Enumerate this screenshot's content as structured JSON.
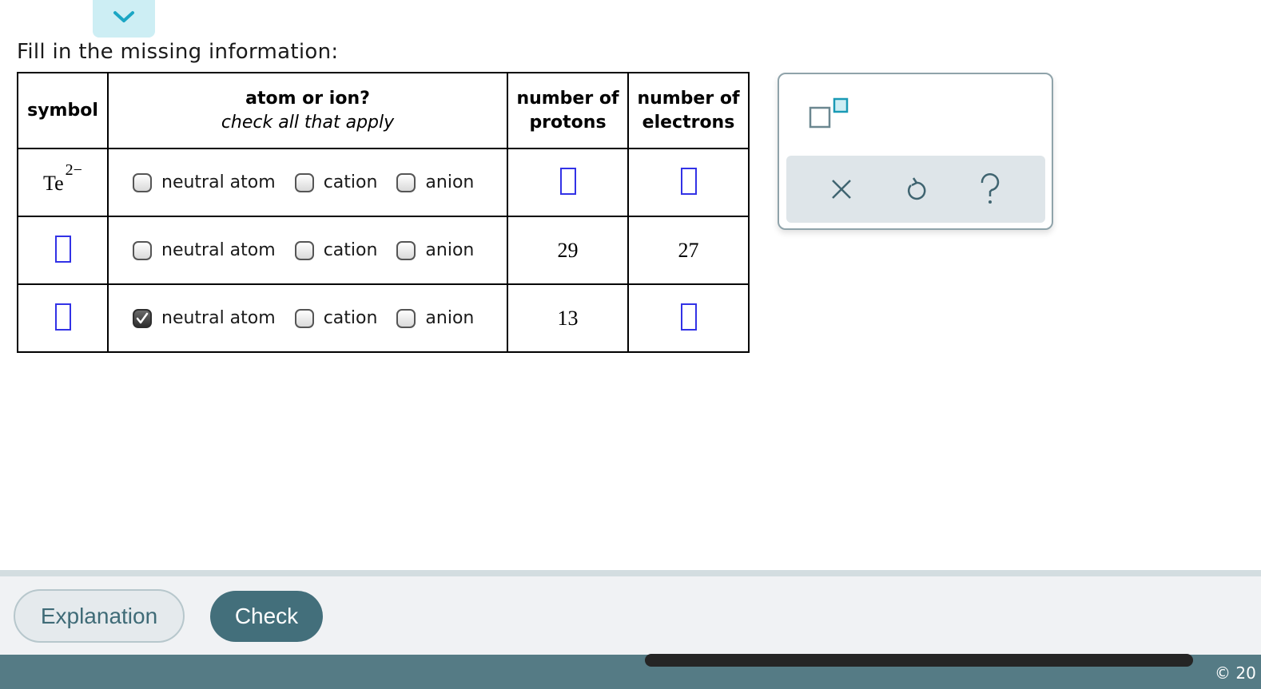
{
  "prompt": "Fill in the missing information:",
  "table": {
    "headers": {
      "symbol": "symbol",
      "atom_or_ion": "atom or ion?",
      "atom_or_ion_sub": "check all that apply",
      "protons_line1": "number of",
      "protons_line2": "protons",
      "electrons_line1": "number of",
      "electrons_line2": "electrons"
    },
    "options": [
      "neutral atom",
      "cation",
      "anion"
    ],
    "rows": [
      {
        "symbol": "Te",
        "charge": "2−",
        "symbol_blank": false,
        "checked": [
          false,
          false,
          false
        ],
        "protons": null,
        "electrons": null
      },
      {
        "symbol": null,
        "charge": null,
        "symbol_blank": true,
        "checked": [
          false,
          false,
          false
        ],
        "protons": "29",
        "electrons": "27"
      },
      {
        "symbol": null,
        "charge": null,
        "symbol_blank": true,
        "checked": [
          true,
          false,
          false
        ],
        "protons": "13",
        "electrons": null
      }
    ]
  },
  "palette": {
    "superscript_icon": "superscript-template-icon",
    "tools": [
      {
        "name": "clear",
        "icon": "close-icon"
      },
      {
        "name": "undo",
        "icon": "undo-icon"
      },
      {
        "name": "help",
        "icon": "help-icon"
      }
    ]
  },
  "footer": {
    "explanation_label": "Explanation",
    "check_label": "Check",
    "copyright": "© 20"
  },
  "colors": {
    "accent": "#436f7b",
    "blank_border": "#3232e6",
    "bottom_bar": "#557b85",
    "tab_bg": "#cdeef4"
  }
}
